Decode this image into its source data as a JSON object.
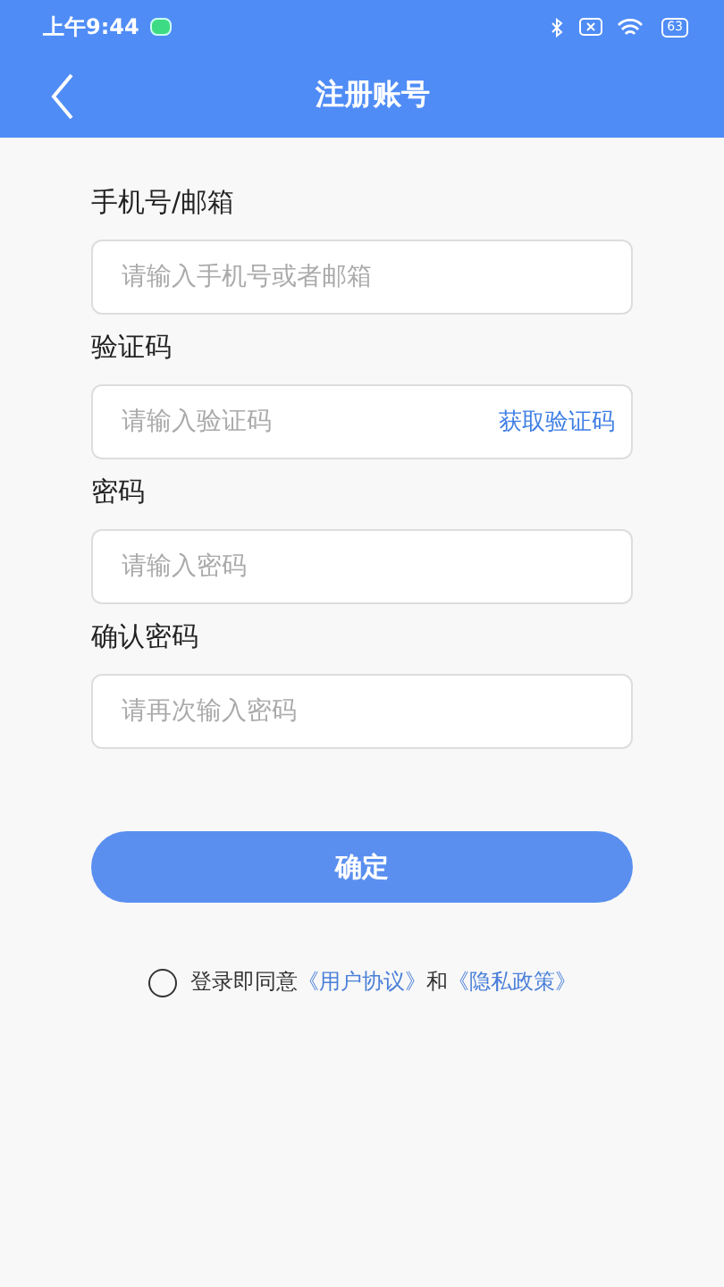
{
  "status_bar": {
    "time": "上午9:44",
    "battery": "63"
  },
  "nav": {
    "title": "注册账号"
  },
  "fields": [
    {
      "label": "手机号/邮箱",
      "placeholder": "请输入手机号或者邮箱"
    },
    {
      "label": "验证码",
      "placeholder": "请输入验证码",
      "action": "获取验证码"
    },
    {
      "label": "密码",
      "placeholder": "请输入密码"
    },
    {
      "label": "确认密码",
      "placeholder": "请再次输入密码"
    }
  ],
  "submit": "确定",
  "agreement": {
    "checked": false,
    "text": "登录即同意",
    "link_1": "《用户协议》",
    "joiner": "和",
    "link_2": "《隐私政策》"
  }
}
